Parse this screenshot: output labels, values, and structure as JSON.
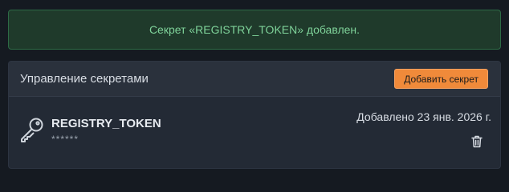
{
  "flash": {
    "message": "Секрет «REGISTRY_TOKEN» добавлен."
  },
  "panel": {
    "title": "Управление секретами",
    "add_button_label": "Добавить секрет"
  },
  "secrets": [
    {
      "name": "REGISTRY_TOKEN",
      "masked_value": "******",
      "added_text": "Добавлено 23 янв. 2026 г.",
      "icon": "key-icon",
      "delete_icon": "trash-icon"
    }
  ],
  "colors": {
    "background": "#151a21",
    "success_bg": "#1f3a2b",
    "success_text": "#7fd39a",
    "accent": "#f08a3a"
  }
}
